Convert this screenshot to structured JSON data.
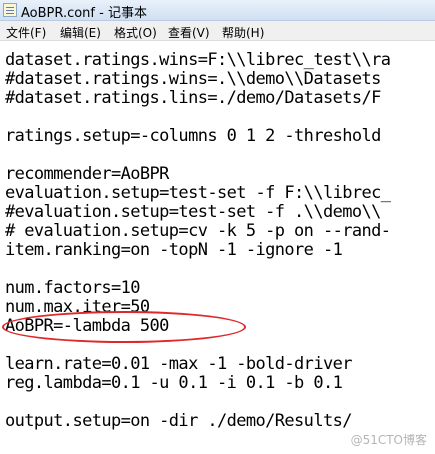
{
  "window": {
    "title": "AoBPR.conf - 记事本"
  },
  "menu": {
    "items": [
      "文件(F)",
      "编辑(E)",
      "格式(O)",
      "查看(V)",
      "帮助(H)"
    ]
  },
  "editor": {
    "lines": [
      "dataset.ratings.wins=F:\\\\librec_test\\\\ra",
      "#dataset.ratings.wins=.\\\\demo\\\\Datasets",
      "#dataset.ratings.lins=./demo/Datasets/F",
      "",
      "ratings.setup=-columns 0 1 2 -threshold",
      "",
      "recommender=AoBPR",
      "evaluation.setup=test-set -f F:\\\\librec_",
      "#evaluation.setup=test-set -f .\\\\demo\\\\",
      "# evaluation.setup=cv -k 5 -p on --rand-",
      "item.ranking=on -topN -1 -ignore -1",
      "",
      "num.factors=10",
      "num.max.iter=50",
      "AoBPR=-lambda 500",
      "",
      "learn.rate=0.01 -max -1 -bold-driver",
      "reg.lambda=0.1 -u 0.1 -i 0.1 -b 0.1",
      "",
      "output.setup=on -dir ./demo/Results/"
    ]
  },
  "watermark": {
    "text": "@51CTO博客"
  },
  "colors": {
    "highlight": "#e0282a"
  }
}
